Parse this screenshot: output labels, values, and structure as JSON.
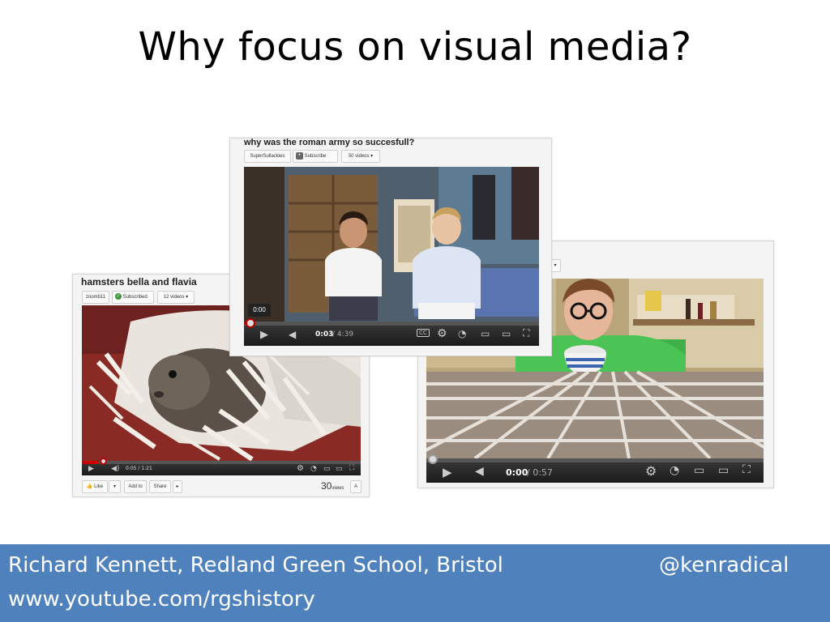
{
  "slide": {
    "title": "Why focus on visual media?"
  },
  "videos": {
    "hamsters": {
      "title": "hamsters bella and flavia",
      "channel": "zoomb11",
      "subscribe_label": "Subscribed",
      "videos_dropdown": "12 videos ▾",
      "time": "0:05 / 1:21",
      "like_label": "Like",
      "add_to_label": "Add to",
      "share_label": "Share",
      "views_count": "30",
      "views_label": "views",
      "progress_fraction": 0.06
    },
    "roman": {
      "title": "why was the roman army so succesfull?",
      "channel": "SuperSullackies",
      "subscribe_label": "Subscribe",
      "videos_dropdown": "50 videos ▾",
      "time_current": "0:03",
      "time_total": "/ 4:39",
      "time_tooltip": "0:00",
      "progress_fraction": 0.01
    },
    "glasses": {
      "time_current": "0:00",
      "time_total": "/ 0:57",
      "progress_fraction": 0.0
    }
  },
  "footer": {
    "author": "Richard Kennett, Redland Green School, Bristol",
    "handle": "@kenradical",
    "url": "www.youtube.com/rgshistory"
  },
  "colors": {
    "footer_bg": "#4f81bd",
    "progress_red": "#cc0000"
  },
  "icons": [
    "play-icon",
    "volume-icon",
    "cc-icon",
    "gear-icon",
    "clock-icon",
    "small-player-icon",
    "large-player-icon",
    "fullscreen-icon",
    "thumbs-down-icon",
    "checkmark-icon"
  ]
}
